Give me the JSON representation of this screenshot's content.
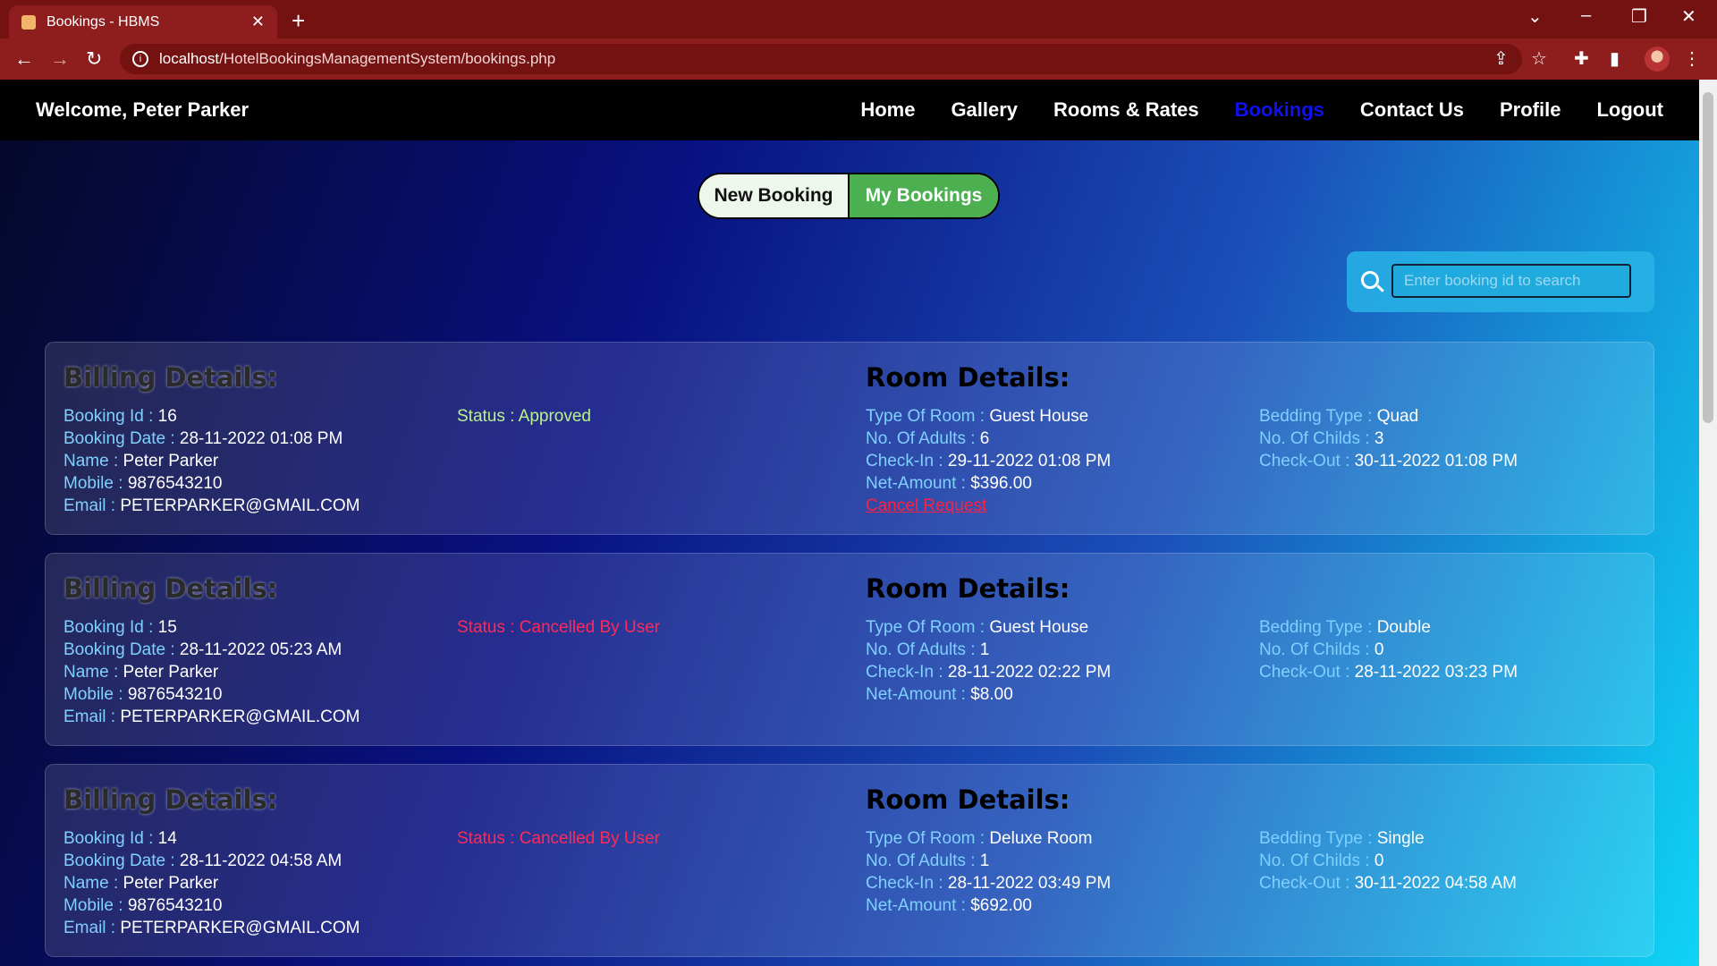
{
  "browser": {
    "tab_title": "Bookings - HBMS",
    "url_host": "localhost",
    "url_path": "/HotelBookingsManagementSystem/bookings.php"
  },
  "nav": {
    "welcome": "Welcome, Peter Parker",
    "links": [
      "Home",
      "Gallery",
      "Rooms & Rates",
      "Bookings",
      "Contact Us",
      "Profile",
      "Logout"
    ],
    "active": "Bookings"
  },
  "toggle": {
    "new_label": "New Booking",
    "mine_label": "My Bookings"
  },
  "search": {
    "placeholder": "Enter booking id to search"
  },
  "labels": {
    "billing_heading": "Billing Details:",
    "room_heading": "Room Details:",
    "booking_id": "Booking Id : ",
    "booking_date": "Booking Date : ",
    "name": "Name : ",
    "mobile": "Mobile : ",
    "email": "Email : ",
    "status": "Status : ",
    "room_type": "Type Of Room : ",
    "adults": "No. Of Adults : ",
    "check_in": "Check-In : ",
    "net_amount": "Net-Amount : ",
    "bedding": "Bedding Type : ",
    "childs": "No. Of Childs : ",
    "check_out": "Check-Out : ",
    "cancel_request": "Cancel Request"
  },
  "bookings": [
    {
      "id": "16",
      "date": "28-11-2022 01:08 PM",
      "name": "Peter Parker",
      "mobile": "9876543210",
      "email": "PETERPARKER@GMAIL.COM",
      "status": "Approved",
      "room_type": "Guest House",
      "adults": "6",
      "check_in": "29-11-2022 01:08 PM",
      "net_amount": "$396.00",
      "bedding": "Quad",
      "childs": "3",
      "check_out": "30-11-2022 01:08 PM"
    },
    {
      "id": "15",
      "date": "28-11-2022 05:23 AM",
      "name": "Peter Parker",
      "mobile": "9876543210",
      "email": "PETERPARKER@GMAIL.COM",
      "status": "Cancelled By User",
      "room_type": "Guest House",
      "adults": "1",
      "check_in": "28-11-2022 02:22 PM",
      "net_amount": "$8.00",
      "bedding": "Double",
      "childs": "0",
      "check_out": "28-11-2022 03:23 PM"
    },
    {
      "id": "14",
      "date": "28-11-2022 04:58 AM",
      "name": "Peter Parker",
      "mobile": "9876543210",
      "email": "PETERPARKER@GMAIL.COM",
      "status": "Cancelled By User",
      "room_type": "Deluxe Room",
      "adults": "1",
      "check_in": "28-11-2022 03:49 PM",
      "net_amount": "$692.00",
      "bedding": "Single",
      "childs": "0",
      "check_out": "30-11-2022 04:58 AM"
    }
  ]
}
